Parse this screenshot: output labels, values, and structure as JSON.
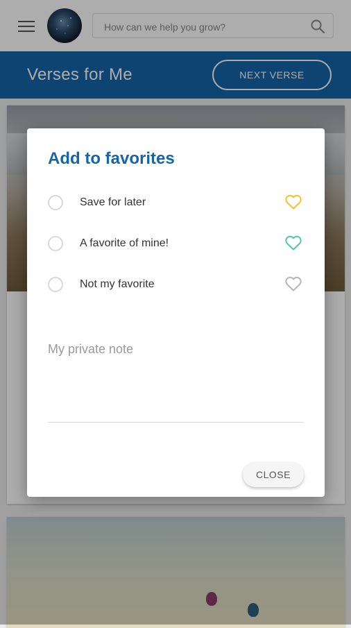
{
  "header": {
    "search": {
      "placeholder": "How can we help you grow?"
    }
  },
  "titlebar": {
    "title": "Verses for Me",
    "next_label": "NEXT VERSE"
  },
  "dialog": {
    "title": "Add to favorites",
    "options": [
      {
        "label": "Save for later",
        "heart_color": "#f2c12e"
      },
      {
        "label": "A favorite of mine!",
        "heart_color": "#4ec9a0"
      },
      {
        "label": "Not my favorite",
        "heart_color": "#b5b5b5"
      }
    ],
    "note_placeholder": "My private note",
    "close_label": "CLOSE"
  },
  "colors": {
    "brand_blue": "#1565a8"
  }
}
